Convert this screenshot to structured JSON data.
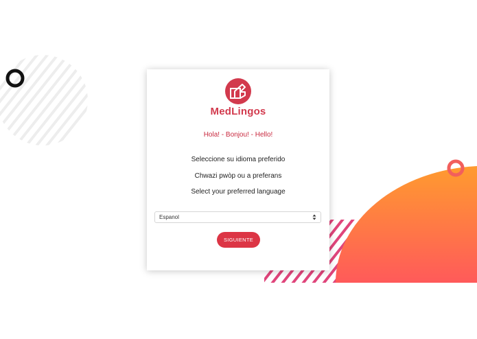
{
  "brand": {
    "name": "MedLingos"
  },
  "greeting": "Hola! - Bonjou! - Hello!",
  "prompts": {
    "spanish": "Seleccione su idioma preferido",
    "creole": "Chwazi pwòp ou a preferans",
    "english": "Select your preferred language"
  },
  "language_select": {
    "selected": "Espanol"
  },
  "next_button": {
    "label": "SIGUIENTE"
  },
  "colors": {
    "brand_red": "#dc3545",
    "gradient_top": "#ff9b2f",
    "gradient_bottom": "#ff5a5a",
    "stripe_pink": "#e0457b",
    "stripe_gray": "#efefef"
  },
  "icons": [
    "medlingos-logo-icon",
    "select-arrows-icon"
  ]
}
